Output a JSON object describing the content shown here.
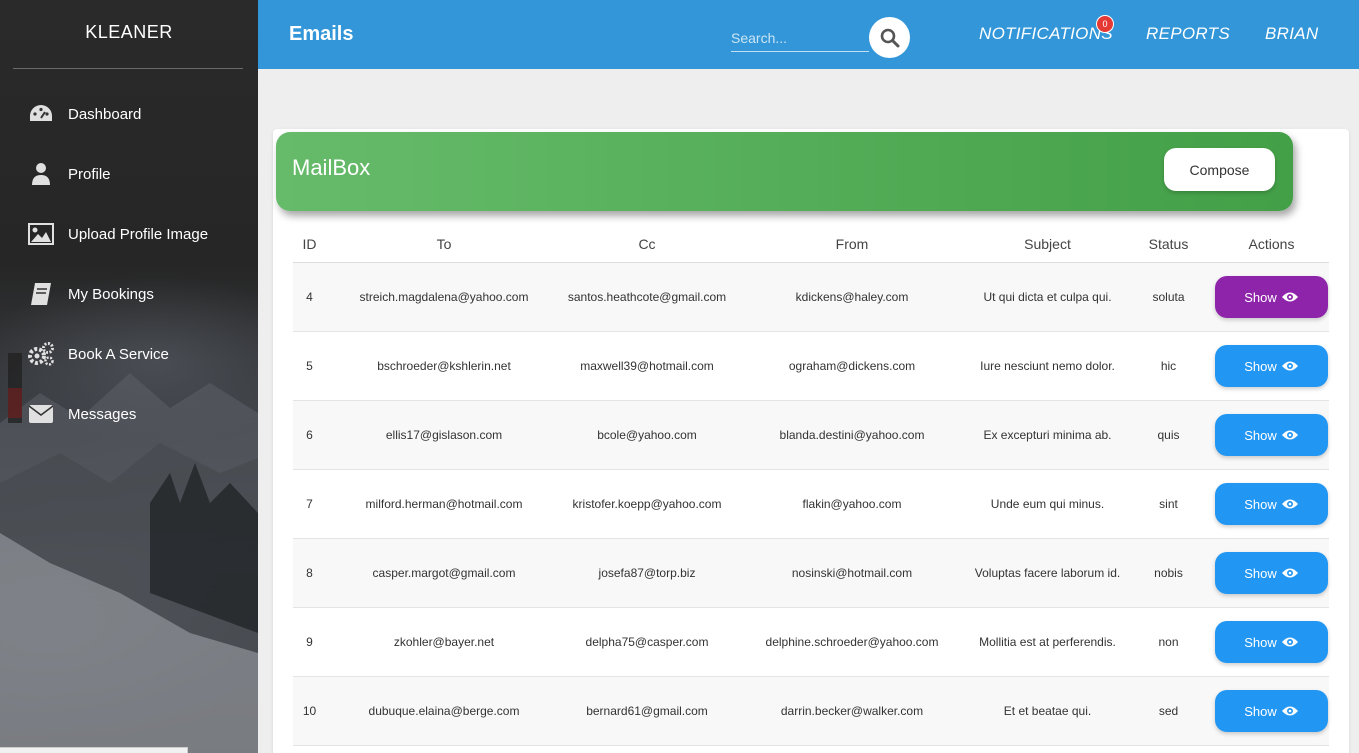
{
  "sidebar": {
    "brand": "KLEANER",
    "items": [
      {
        "label": "Dashboard",
        "icon": "dashboard-icon"
      },
      {
        "label": "Profile",
        "icon": "user-icon"
      },
      {
        "label": "Upload Profile Image",
        "icon": "image-icon"
      },
      {
        "label": "My Bookings",
        "icon": "book-icon"
      },
      {
        "label": "Book A Service",
        "icon": "gears-icon"
      },
      {
        "label": "Messages",
        "icon": "envelope-icon"
      }
    ]
  },
  "header": {
    "title": "Emails",
    "search_placeholder": "Search...",
    "notifications_label": "NOTIFICATIONS",
    "notifications_count": "0",
    "reports_label": "REPORTS",
    "user_label": "BRIAN"
  },
  "mailbox": {
    "title": "MailBox",
    "compose_label": "Compose",
    "columns": [
      "ID",
      "To",
      "Cc",
      "From",
      "Subject",
      "Status",
      "Actions"
    ],
    "rows": [
      {
        "id": "4",
        "to": "streich.magdalena@yahoo.com",
        "cc": "santos.heathcote@gmail.com",
        "from": "kdickens@haley.com",
        "subject": "Ut qui dicta et culpa qui.",
        "status": "soluta",
        "action": "Show"
      },
      {
        "id": "5",
        "to": "bschroeder@kshlerin.net",
        "cc": "maxwell39@hotmail.com",
        "from": "ograham@dickens.com",
        "subject": "Iure nesciunt nemo dolor.",
        "status": "hic",
        "action": "Show"
      },
      {
        "id": "6",
        "to": "ellis17@gislason.com",
        "cc": "bcole@yahoo.com",
        "from": "blanda.destini@yahoo.com",
        "subject": "Ex excepturi minima ab.",
        "status": "quis",
        "action": "Show"
      },
      {
        "id": "7",
        "to": "milford.herman@hotmail.com",
        "cc": "kristofer.koepp@yahoo.com",
        "from": "flakin@yahoo.com",
        "subject": "Unde eum qui minus.",
        "status": "sint",
        "action": "Show"
      },
      {
        "id": "8",
        "to": "casper.margot@gmail.com",
        "cc": "josefa87@torp.biz",
        "from": "nosinski@hotmail.com",
        "subject": "Voluptas facere laborum id.",
        "status": "nobis",
        "action": "Show"
      },
      {
        "id": "9",
        "to": "zkohler@bayer.net",
        "cc": "delpha75@casper.com",
        "from": "delphine.schroeder@yahoo.com",
        "subject": "Mollitia est at perferendis.",
        "status": "non",
        "action": "Show"
      },
      {
        "id": "10",
        "to": "dubuque.elaina@berge.com",
        "cc": "bernard61@gmail.com",
        "from": "darrin.becker@walker.com",
        "subject": "Et et beatae qui.",
        "status": "sed",
        "action": "Show"
      }
    ]
  },
  "colors": {
    "topbar": "#3296d8",
    "header_green": "#4caf50",
    "show_button": "#2196f3",
    "show_button_active": "#8e24aa",
    "badge": "#e53935"
  }
}
